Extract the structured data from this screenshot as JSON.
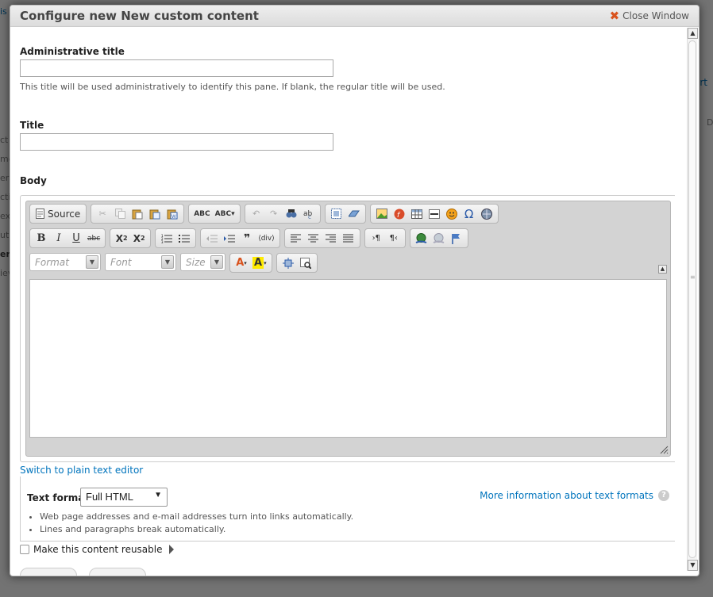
{
  "modal": {
    "title": "Configure new New custom content",
    "close_label": "Close Window"
  },
  "admin_title": {
    "label": "Administrative title",
    "value": "",
    "description": "This title will be used administratively to identify this pane. If blank, the regular title will be used."
  },
  "title_field": {
    "label": "Title",
    "value": ""
  },
  "body": {
    "label": "Body",
    "toolbar": {
      "source_label": "Source",
      "format_placeholder": "Format",
      "font_placeholder": "Font",
      "size_placeholder": "Size"
    },
    "switch_link": "Switch to plain text editor"
  },
  "text_format": {
    "label": "Text format",
    "selected": "Full HTML",
    "more_info_link": "More information about text formats",
    "tips": [
      "Web page addresses and e-mail addresses turn into links automatically.",
      "Lines and paragraphs break automatically."
    ]
  },
  "reusable": {
    "label": "Make this content reusable",
    "checked": false
  },
  "background_fragments": [
    "is",
    "ort",
    "D",
    "ct",
    "me",
    "era",
    "ctic",
    "ex",
    "ut",
    "er",
    "iev"
  ],
  "colors": {
    "link": "#0074bd",
    "close_x": "#d9531e"
  }
}
